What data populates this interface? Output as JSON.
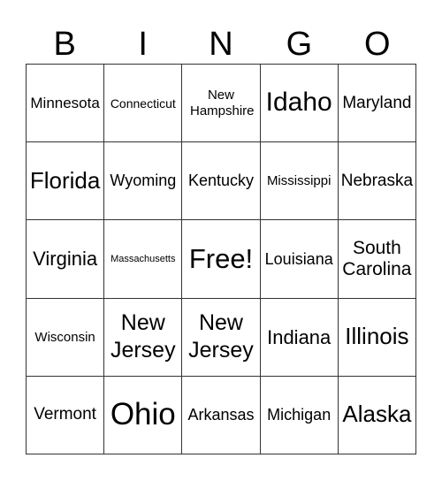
{
  "header": {
    "letters": [
      "B",
      "I",
      "N",
      "G",
      "O"
    ]
  },
  "board": {
    "rows": [
      [
        "Minnesota",
        "Connecticut",
        "New Hampshire",
        "Idaho",
        "Maryland"
      ],
      [
        "Florida",
        "Wyoming",
        "Kentucky",
        "Mississippi",
        "Nebraska"
      ],
      [
        "Virginia",
        "Massachusetts",
        "Free!",
        "Louisiana",
        "South Carolina"
      ],
      [
        "Wisconsin",
        "New Jersey",
        "New Jersey",
        "Indiana",
        "Illinois"
      ],
      [
        "Vermont",
        "Ohio",
        "Arkansas",
        "Michigan",
        "Alaska"
      ]
    ]
  }
}
